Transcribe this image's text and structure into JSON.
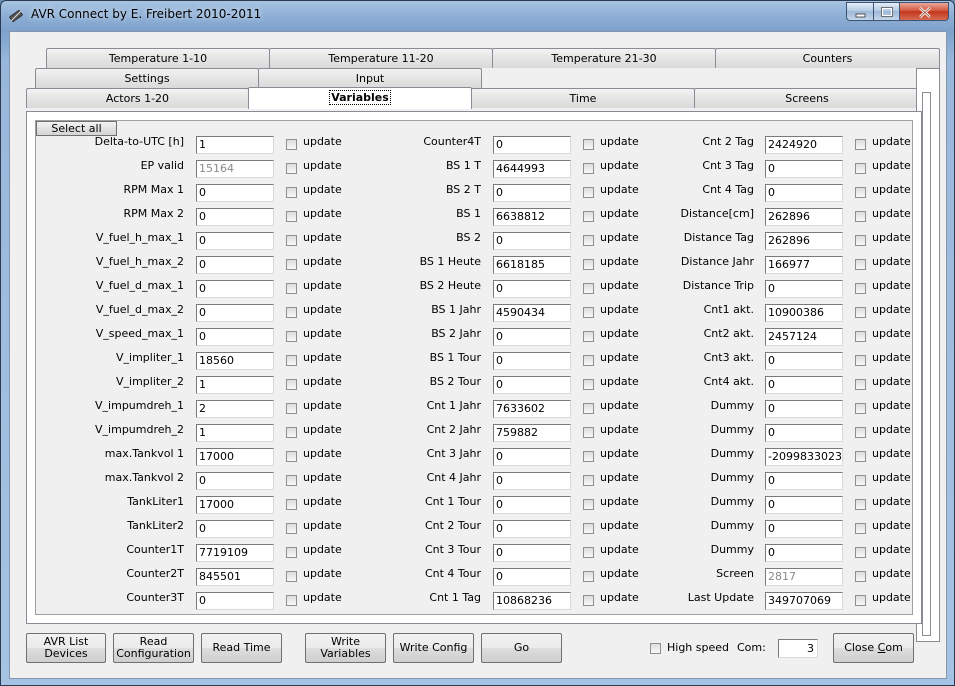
{
  "window": {
    "title": "AVR Connect by E. Freibert 2010-2011"
  },
  "tabs": {
    "row1": [
      "Temperature 1-10",
      "Temperature 11-20",
      "Temperature 21-30",
      "Counters"
    ],
    "row2": [
      "Settings",
      "Input"
    ],
    "row3": [
      "Actors 1-20",
      "Variables",
      "Time",
      "Screens"
    ],
    "active": "Variables"
  },
  "select_all_label": "Select all",
  "update_label": "update",
  "columns": [
    [
      {
        "label": "Delta-to-UTC [h]",
        "value": "1",
        "readonly": false
      },
      {
        "label": "EP valid",
        "value": "15164",
        "readonly": true
      },
      {
        "label": "RPM Max 1",
        "value": "0",
        "readonly": false
      },
      {
        "label": "RPM Max 2",
        "value": "0",
        "readonly": false
      },
      {
        "label": "V_fuel_h_max_1",
        "value": "0",
        "readonly": false
      },
      {
        "label": "V_fuel_h_max_2",
        "value": "0",
        "readonly": false
      },
      {
        "label": "V_fuel_d_max_1",
        "value": "0",
        "readonly": false
      },
      {
        "label": "V_fuel_d_max_2",
        "value": "0",
        "readonly": false
      },
      {
        "label": "V_speed_max_1",
        "value": "0",
        "readonly": false
      },
      {
        "label": "V_impliter_1",
        "value": "18560",
        "readonly": false
      },
      {
        "label": "V_impliter_2",
        "value": "1",
        "readonly": false
      },
      {
        "label": "V_impumdreh_1",
        "value": "2",
        "readonly": false
      },
      {
        "label": "V_impumdreh_2",
        "value": "1",
        "readonly": false
      },
      {
        "label": "max.Tankvol 1",
        "value": "17000",
        "readonly": false
      },
      {
        "label": "max.Tankvol 2",
        "value": "0",
        "readonly": false
      },
      {
        "label": "TankLiter1",
        "value": "17000",
        "readonly": false
      },
      {
        "label": "TankLiter2",
        "value": "0",
        "readonly": false
      },
      {
        "label": "Counter1T",
        "value": "7719109",
        "readonly": false
      },
      {
        "label": "Counter2T",
        "value": "845501",
        "readonly": false
      },
      {
        "label": "Counter3T",
        "value": "0",
        "readonly": false
      }
    ],
    [
      {
        "label": "Counter4T",
        "value": "0",
        "readonly": false
      },
      {
        "label": "BS 1 T",
        "value": "4644993",
        "readonly": false
      },
      {
        "label": "BS 2 T",
        "value": "0",
        "readonly": false
      },
      {
        "label": "BS 1",
        "value": "6638812",
        "readonly": false
      },
      {
        "label": "BS 2",
        "value": "0",
        "readonly": false
      },
      {
        "label": "BS 1 Heute",
        "value": "6618185",
        "readonly": false
      },
      {
        "label": "BS 2 Heute",
        "value": "0",
        "readonly": false
      },
      {
        "label": "BS 1 Jahr",
        "value": "4590434",
        "readonly": false
      },
      {
        "label": "BS 2 Jahr",
        "value": "0",
        "readonly": false
      },
      {
        "label": "BS 1 Tour",
        "value": "0",
        "readonly": false
      },
      {
        "label": "BS 2 Tour",
        "value": "0",
        "readonly": false
      },
      {
        "label": "Cnt 1 Jahr",
        "value": "7633602",
        "readonly": false
      },
      {
        "label": "Cnt 2 Jahr",
        "value": "759882",
        "readonly": false
      },
      {
        "label": "Cnt 3 Jahr",
        "value": "0",
        "readonly": false
      },
      {
        "label": "Cnt 4 Jahr",
        "value": "0",
        "readonly": false
      },
      {
        "label": "Cnt 1 Tour",
        "value": "0",
        "readonly": false
      },
      {
        "label": "Cnt 2 Tour",
        "value": "0",
        "readonly": false
      },
      {
        "label": "Cnt 3 Tour",
        "value": "0",
        "readonly": false
      },
      {
        "label": "Cnt 4 Tour",
        "value": "0",
        "readonly": false
      },
      {
        "label": "Cnt 1 Tag",
        "value": "10868236",
        "readonly": false
      }
    ],
    [
      {
        "label": "Cnt 2 Tag",
        "value": "2424920",
        "readonly": false
      },
      {
        "label": "Cnt 3 Tag",
        "value": "0",
        "readonly": false
      },
      {
        "label": "Cnt 4 Tag",
        "value": "0",
        "readonly": false
      },
      {
        "label": "Distance[cm]",
        "value": "262896",
        "readonly": false
      },
      {
        "label": "Distance Tag",
        "value": "262896",
        "readonly": false
      },
      {
        "label": "Distance Jahr",
        "value": "166977",
        "readonly": false
      },
      {
        "label": "Distance Trip",
        "value": "0",
        "readonly": false
      },
      {
        "label": "Cnt1 akt.",
        "value": "10900386",
        "readonly": false
      },
      {
        "label": "Cnt2 akt.",
        "value": "2457124",
        "readonly": false
      },
      {
        "label": "Cnt3 akt.",
        "value": "0",
        "readonly": false
      },
      {
        "label": "Cnt4 akt.",
        "value": "0",
        "readonly": false
      },
      {
        "label": "Dummy",
        "value": "0",
        "readonly": false
      },
      {
        "label": "Dummy",
        "value": "0",
        "readonly": false
      },
      {
        "label": "Dummy",
        "value": "-2099833023",
        "readonly": false
      },
      {
        "label": "Dummy",
        "value": "0",
        "readonly": false
      },
      {
        "label": "Dummy",
        "value": "0",
        "readonly": false
      },
      {
        "label": "Dummy",
        "value": "0",
        "readonly": false
      },
      {
        "label": "Dummy",
        "value": "0",
        "readonly": false
      },
      {
        "label": "Screen",
        "value": "2817",
        "readonly": true
      },
      {
        "label": "Last Update",
        "value": "349707069",
        "readonly": false
      }
    ]
  ],
  "bottom": {
    "avr_list_line1": "AVR List",
    "avr_list_line2": "Devices",
    "read_config_line1": "Read",
    "read_config_line2": "Configuration",
    "read_time": "Read Time",
    "write_variables": "Write Variables",
    "write_config": "Write Config",
    "go": "Go",
    "high_speed_label": "High speed",
    "com_label": "Com:",
    "com_value": "3",
    "close_com_pre": "Close ",
    "close_com_u": "C",
    "close_com_post": "om"
  }
}
